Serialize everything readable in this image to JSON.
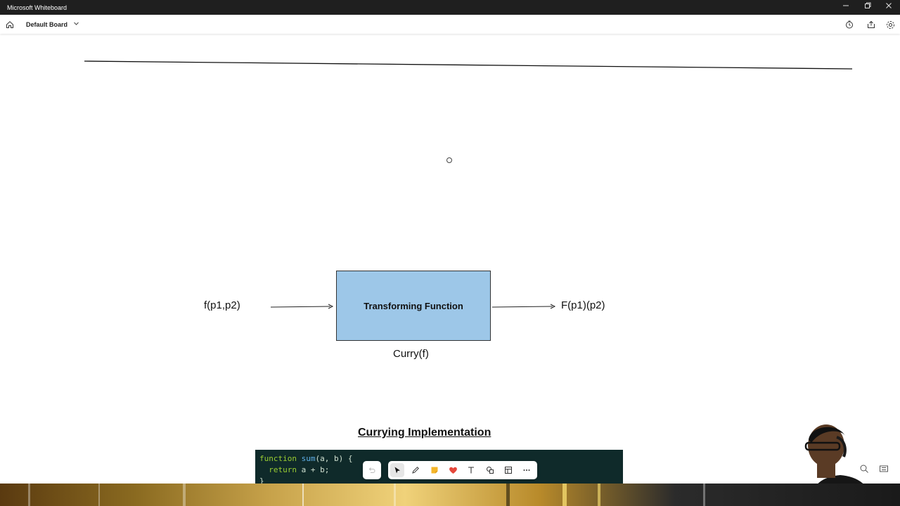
{
  "window": {
    "title": "Microsoft Whiteboard",
    "controls": [
      "minimize-icon",
      "restore-icon",
      "close-icon"
    ]
  },
  "appbar": {
    "board_name": "Default Board",
    "left_icons": [
      "home-icon",
      "chevron-down-icon"
    ],
    "right_icons": [
      "timer-icon",
      "share-icon",
      "settings-icon"
    ]
  },
  "diagram": {
    "input_label": "f(p1,p2)",
    "box_label": "Transforming Function",
    "box_caption": "Curry(f)",
    "output_label": "F(p1)(p2)",
    "box_color": "#9dc7e8"
  },
  "section": {
    "heading": "Currying Implementation"
  },
  "code": {
    "line1_kw": "function",
    "line1_fn": "sum",
    "line1_rest": "(a, b) {",
    "line2_kw": "return",
    "line2_rest": " a + b;",
    "line3": "}"
  },
  "toolbar": {
    "tools": [
      "undo-icon",
      "select-icon",
      "pen-icon",
      "sticky-note-icon",
      "reaction-icon",
      "text-icon",
      "shapes-icon",
      "template-icon",
      "more-icon"
    ]
  }
}
